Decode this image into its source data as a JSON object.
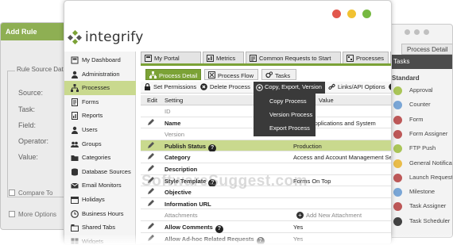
{
  "left_window": {
    "header": "Add Rule",
    "group_label": "Rule Source Data",
    "fields": [
      "Source:",
      "Task:",
      "Field:",
      "Operator:",
      "Value:"
    ],
    "checkboxes": [
      "Compare To",
      "More Options"
    ]
  },
  "right_window": {
    "tab": "Process Detail",
    "panel_title": "Tasks",
    "section": "Standard",
    "tasks": [
      {
        "label": "Approval",
        "color": "#a3c14a"
      },
      {
        "label": "Counter",
        "color": "#6f9fd3"
      },
      {
        "label": "Form",
        "color": "#b84a4a"
      },
      {
        "label": "Form Assigner",
        "color": "#b84a4a"
      },
      {
        "label": "FTP Push",
        "color": "#a3c14a"
      },
      {
        "label": "General Notifications",
        "color": "#e8b73a"
      },
      {
        "label": "Launch Request",
        "color": "#b84a4a"
      },
      {
        "label": "Milestone",
        "color": "#6f9fd3"
      },
      {
        "label": "Task Assigner",
        "color": "#b84a4a"
      },
      {
        "label": "Task Scheduler",
        "color": "#333333"
      }
    ]
  },
  "app": {
    "logo_text": "integrify",
    "window_buttons": [
      "#e2574c",
      "#f1c232",
      "#76b941"
    ]
  },
  "sidebar": {
    "items": [
      {
        "label": "My Dashboard",
        "icon": "dashboard-icon"
      },
      {
        "label": "Administration",
        "icon": "user-icon"
      },
      {
        "label": "Processes",
        "icon": "process-icon",
        "active": true
      },
      {
        "label": "Forms",
        "icon": "form-icon"
      },
      {
        "label": "Reports",
        "icon": "report-icon"
      },
      {
        "label": "Users",
        "icon": "user-icon"
      },
      {
        "label": "Groups",
        "icon": "group-icon"
      },
      {
        "label": "Categories",
        "icon": "folder-icon"
      },
      {
        "label": "Database Sources",
        "icon": "database-icon"
      },
      {
        "label": "Email Monitors",
        "icon": "email-icon"
      },
      {
        "label": "Holidays",
        "icon": "calendar-icon"
      },
      {
        "label": "Business Hours",
        "icon": "clock-icon"
      },
      {
        "label": "Shared Tabs",
        "icon": "tab-icon"
      },
      {
        "label": "Widgets",
        "icon": "widget-icon"
      }
    ]
  },
  "tabs": [
    {
      "label": "My Portal"
    },
    {
      "label": "Metrics"
    },
    {
      "label": "Common Requests to Start"
    },
    {
      "label": "Processes"
    },
    {
      "label": "",
      "active": true
    }
  ],
  "subtabs": [
    {
      "label": "Process Detail",
      "active": true
    },
    {
      "label": "Process Flow"
    },
    {
      "label": "Tasks"
    }
  ],
  "toolbar": {
    "set_permissions": "Set Permissions",
    "delete_process": "Delete Process",
    "copy_export_version": "Copy, Export, Version",
    "links_api": "Links/API Options"
  },
  "dropdown": [
    "Copy Process",
    "Version Process",
    "Export Process"
  ],
  "table": {
    "headers": {
      "edit": "Edit",
      "setting": "Setting",
      "value": "Value"
    },
    "rows": [
      {
        "setting": "ID",
        "value": "",
        "style": "grey",
        "edit": false
      },
      {
        "setting": "Name",
        "value": "ess to Applications and System",
        "style": "bold",
        "edit": true
      },
      {
        "setting": "Version",
        "value": "",
        "style": "grey",
        "edit": false
      },
      {
        "setting": "Publish Status",
        "value": "Production",
        "style": "bold",
        "edit": true,
        "help": true,
        "highlight": true
      },
      {
        "setting": "Category",
        "value": "Access and Account Management Services",
        "style": "bold",
        "edit": true
      },
      {
        "setting": "Description",
        "value": "",
        "style": "bold",
        "edit": true
      },
      {
        "setting": "Style Template",
        "value": "Forms On Top",
        "style": "bold",
        "edit": true,
        "help": true
      },
      {
        "setting": "Objective",
        "value": "",
        "style": "bold",
        "edit": true
      },
      {
        "setting": "Information URL",
        "value": "",
        "style": "bold",
        "edit": true
      },
      {
        "setting": "Attachments",
        "value": "Add New Attachment",
        "style": "grey",
        "edit": false,
        "add": true
      },
      {
        "setting": "Allow Comments",
        "value": "Yes",
        "style": "bold",
        "edit": true,
        "help": true
      },
      {
        "setting": "Allow Ad-hoc Related Requests",
        "value": "Yes",
        "style": "bold",
        "edit": true,
        "help": true
      }
    ]
  },
  "watermark": "SoftwareSuggest.com"
}
